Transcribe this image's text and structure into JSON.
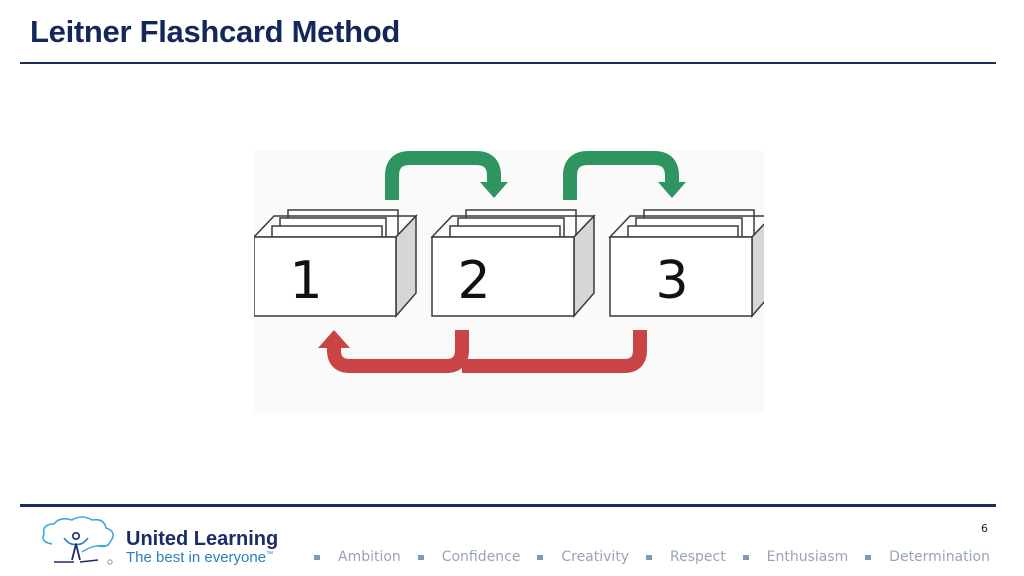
{
  "slide": {
    "title": "Leitner Flashcard Method",
    "page_number": "6"
  },
  "diagram": {
    "boxes": [
      {
        "label": "1"
      },
      {
        "label": "2"
      },
      {
        "label": "3"
      }
    ],
    "colors": {
      "promote_arrow": "#2e9560",
      "demote_arrow": "#c94444",
      "box_stroke": "#3a3a3a",
      "box_side": "#d6d6d6"
    }
  },
  "footer": {
    "brand_name": "United Learning",
    "tagline": "The best in everyone",
    "tagline_mark": "™",
    "values": [
      "Ambition",
      "Confidence",
      "Creativity",
      "Respect",
      "Enthusiasm",
      "Determination"
    ],
    "colors": {
      "brand_navy": "#1d2b66",
      "brand_blue": "#2a7fc1",
      "values_text": "#9aa4b4"
    }
  }
}
